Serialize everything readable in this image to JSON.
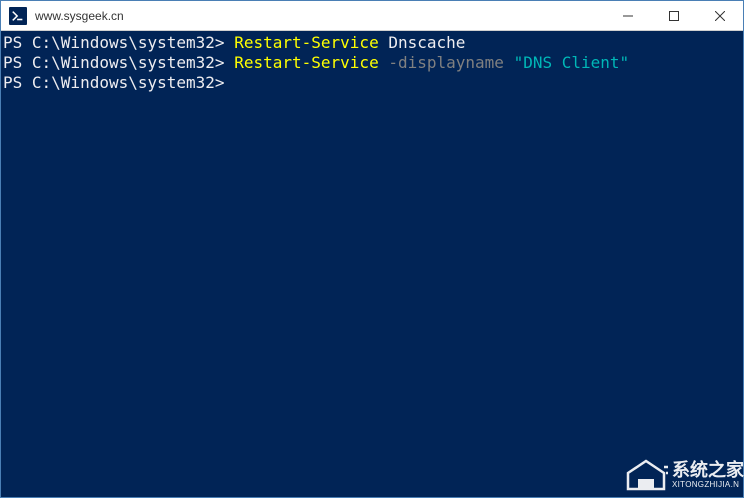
{
  "window": {
    "title": "www.sysgeek.cn"
  },
  "terminal": {
    "lines": [
      {
        "prompt": "PS C:\\Windows\\system32>",
        "command": "Restart-Service",
        "arg": "Dnscache"
      },
      {
        "prompt": "PS C:\\Windows\\system32>",
        "command": "Restart-Service",
        "param": "-displayname",
        "string": "\"DNS Client\""
      },
      {
        "prompt": "PS C:\\Windows\\system32>"
      }
    ]
  },
  "watermark": {
    "name": "系统之家",
    "url": "XITONGZHIJIA.N"
  },
  "controls": {
    "minimize": "—",
    "maximize": "☐",
    "close": "✕"
  }
}
